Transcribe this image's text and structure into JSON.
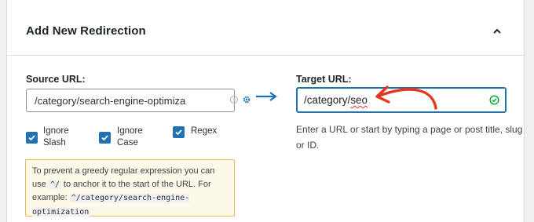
{
  "panel": {
    "title": "Add New Redirection",
    "collapse_icon": "chevron-up-icon"
  },
  "source": {
    "label": "Source URL:",
    "value": "/category/search-engine-optimiza",
    "icons": [
      "clock-icon",
      "gear-icon"
    ]
  },
  "target": {
    "label": "Target URL:",
    "value_plain": "/category/",
    "value_underlined": "seo",
    "status_icon": "check-circle-icon",
    "help_text": "Enter a URL or start by typing a page or post title, slug or ID."
  },
  "options": [
    {
      "label": "Ignore Slash",
      "checked": true
    },
    {
      "label": "Ignore Case",
      "checked": true
    },
    {
      "label": "Regex",
      "checked": true
    }
  ],
  "notice": {
    "text_before": "To prevent a greedy regular expression you can use",
    "code_anchor": "^/",
    "text_after": "to anchor it to the start of the URL. For example:",
    "code_example": "^/category/search-engine-optimization"
  },
  "colors": {
    "accent": "#2271b1",
    "annotation_red": "#e8351e",
    "success_green": "#00a32a",
    "notice_border": "#f0b849"
  }
}
